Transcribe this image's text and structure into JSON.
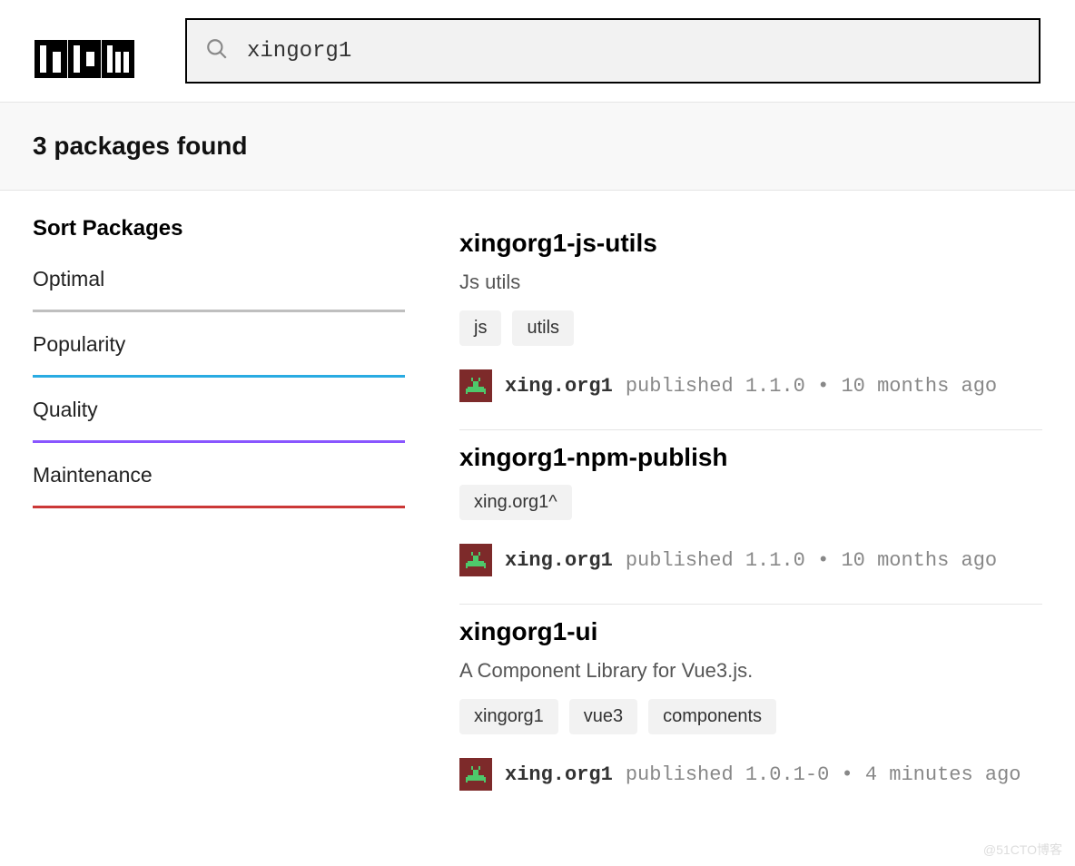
{
  "search": {
    "value": "xingorg1"
  },
  "results_banner": "3 packages found",
  "sidebar": {
    "title": "Sort Packages",
    "options": [
      "Optimal",
      "Popularity",
      "Quality",
      "Maintenance"
    ]
  },
  "packages": [
    {
      "name": "xingorg1-js-utils",
      "description": "Js utils",
      "tags": [
        "js",
        "utils"
      ],
      "author": "xing.org1",
      "publish": "published 1.1.0 • 10 months ago"
    },
    {
      "name": "xingorg1-npm-publish",
      "description": "",
      "tags": [
        "xing.org1^"
      ],
      "author": "xing.org1",
      "publish": "published 1.1.0 • 10 months ago"
    },
    {
      "name": "xingorg1-ui",
      "description": "A Component Library for Vue3.js.",
      "tags": [
        "xingorg1",
        "vue3",
        "components"
      ],
      "author": "xing.org1",
      "publish": "published 1.0.1-0 • 4 minutes ago"
    }
  ],
  "watermark": "@51CTO博客"
}
